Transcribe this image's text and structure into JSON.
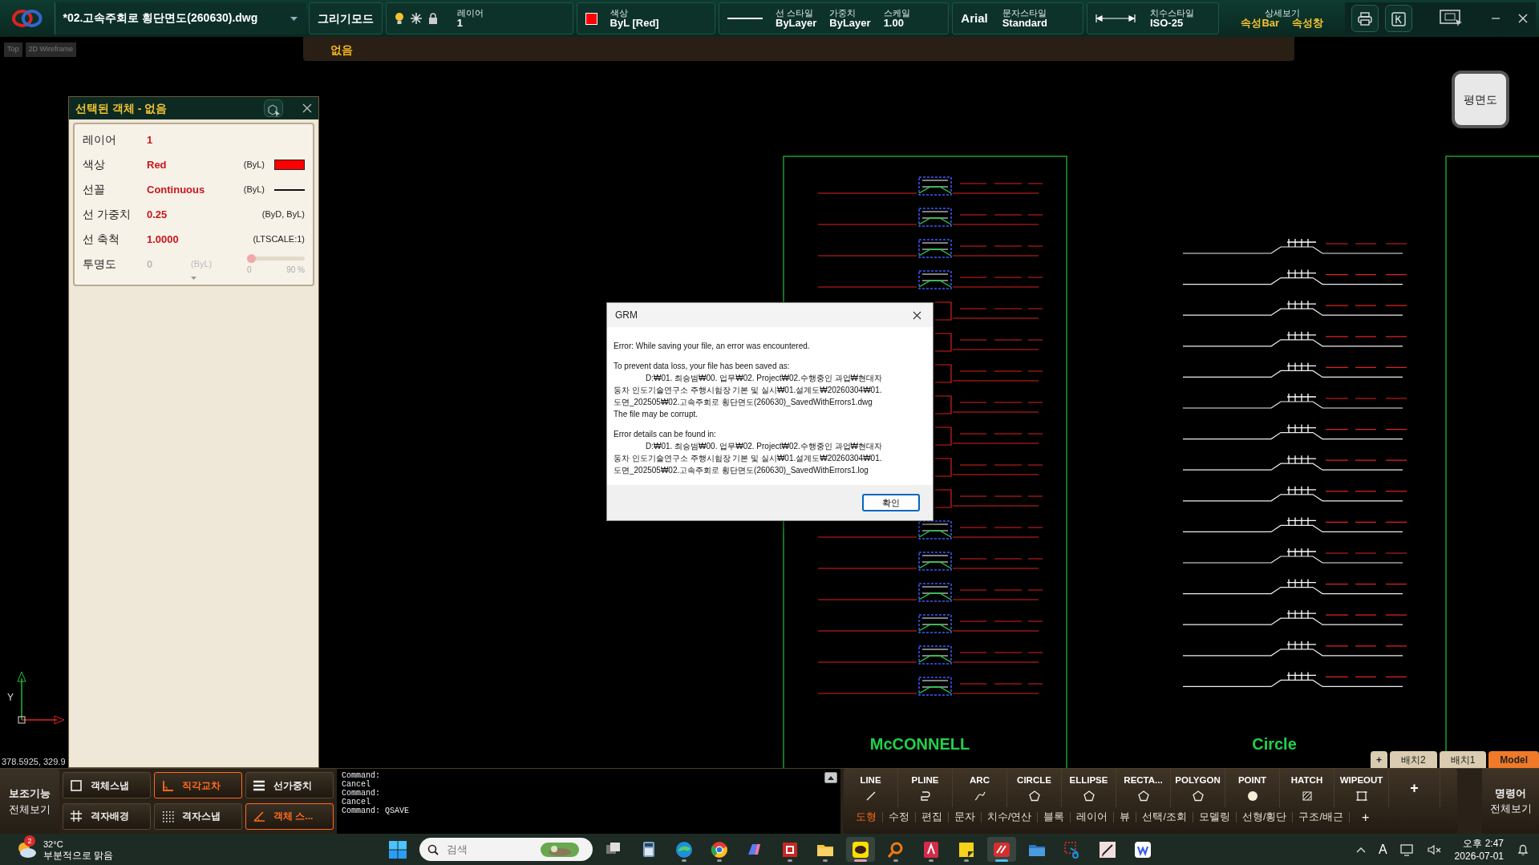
{
  "title_bar": {
    "file_name": "*02.고속주회로 횡단면도(260630).dwg",
    "mode": "그리기모드",
    "layer": {
      "label": "레이어",
      "value": "1"
    },
    "color": {
      "label": "색상",
      "value": "ByL [Red]",
      "color": "#ff0000"
    },
    "line_props": [
      {
        "label": "선 스타일",
        "value": "ByLayer"
      },
      {
        "label": "가중치",
        "value": "ByLayer"
      },
      {
        "label": "스케일",
        "value": "1.00"
      }
    ],
    "font": "Arial",
    "text_style": {
      "label": "문자스타일",
      "value": "Standard"
    },
    "dim_style": {
      "label": "치수스타일",
      "value": "ISO-25"
    },
    "detail": {
      "label": "상세보기",
      "links": [
        "속성Bar",
        "속성창"
      ]
    }
  },
  "selection_strip": "없음",
  "view_labels": [
    "Top",
    "2D Wireframe"
  ],
  "properties": {
    "title": "선택된 객체 - 없음",
    "rows": [
      {
        "kind": "text",
        "label": "레이어",
        "value": "1"
      },
      {
        "kind": "color",
        "label": "색상",
        "value": "Red",
        "source": "(ByL)",
        "color": "#ff0000"
      },
      {
        "kind": "line",
        "label": "선꼴",
        "value": "Continuous",
        "source": "(ByL)"
      },
      {
        "kind": "text",
        "label": "선 가중치",
        "value": "0.25",
        "source": "(ByD, ByL)"
      },
      {
        "kind": "text",
        "label": "선 축척",
        "value": "1.0000",
        "source": "(LTSCALE:1)"
      },
      {
        "kind": "slider",
        "label": "투명도",
        "value": "0",
        "source": "(ByL)",
        "disabled": true,
        "level": 0,
        "min": "0",
        "max": "90 %"
      }
    ]
  },
  "view_button": "평면도",
  "drawing_titles": [
    "McCONNELL",
    "Circle"
  ],
  "ucs": {
    "axis": "Y",
    "coordinates": "378.5925, 329.9"
  },
  "dialog": {
    "title": "GRM",
    "message": "Error: While saving your file, an error was encountered.",
    "saved_intro": "To prevent data loss, your file has been saved as:",
    "saved_path": [
      "D:₩01. 최승범₩00. 업무₩02. Project₩02.수행중인 과업₩현대자",
      "동차 인도기술연구소 주행시험장 기본 및 실시₩01.설계도₩20260304₩01.",
      "도면_202505₩02.고속주회로 횡단면도(260630)_SavedWithErrors1.dwg"
    ],
    "warning": "The file may be corrupt.",
    "details_intro": "Error details can be found in:",
    "details_path": [
      "D:₩01. 최승범₩00. 업무₩02. Project₩02.수행중인 과업₩현대자",
      "동차 인도기술연구소 주행시험장 기본 및 실시₩01.설계도₩20260304₩01.",
      "도면_202505₩02.고속주회로 횡단면도(260630)_SavedWithErrors1.log"
    ],
    "ok": "확인"
  },
  "layout_tabs": {
    "add": "+",
    "tabs": [
      {
        "label": "배치2",
        "selected": false
      },
      {
        "label": "배치1",
        "selected": false
      },
      {
        "label": "Model",
        "selected": true
      }
    ]
  },
  "aux": [
    "보조기능",
    "전체보기"
  ],
  "snaps": [
    {
      "label": "객체스냅",
      "on": false
    },
    {
      "label": "직각교차",
      "on": true
    },
    {
      "label": "선가중치",
      "on": false
    },
    {
      "label": "격자배경",
      "on": false
    },
    {
      "label": "격자스냅",
      "on": false
    },
    {
      "label": "객체 스...",
      "on": true
    }
  ],
  "command_lines": [
    "Command:",
    "Cancel",
    "Command:",
    "Cancel",
    "Command: QSAVE"
  ],
  "tools": [
    "LINE",
    "PLINE",
    "ARC",
    "CIRCLE",
    "ELLIPSE",
    "RECTA...",
    "POLYGON",
    "POINT",
    "HATCH",
    "WIPEOUT"
  ],
  "tools_add": "+",
  "categories": [
    {
      "label": "도형",
      "selected": true
    },
    {
      "label": "수정",
      "selected": false
    },
    {
      "label": "편집",
      "selected": false
    },
    {
      "label": "문자",
      "selected": false
    },
    {
      "label": "치수/연산",
      "selected": false
    },
    {
      "label": "블록",
      "selected": false
    },
    {
      "label": "레이어",
      "selected": false
    },
    {
      "label": "뷰",
      "selected": false
    },
    {
      "label": "선택/조회",
      "selected": false
    },
    {
      "label": "모델링",
      "selected": false
    },
    {
      "label": "선형/횡단",
      "selected": false
    },
    {
      "label": "구조/배근",
      "selected": false
    }
  ],
  "categories_add": "+",
  "command_all": [
    "명령어",
    "전체보기"
  ],
  "taskbar": {
    "weather": {
      "badge": "2",
      "temp": "32°C",
      "text": "부분적으로 맑음"
    },
    "search": {
      "placeholder": "검색"
    },
    "apps": [
      {
        "running": false,
        "active": false
      },
      {
        "running": false,
        "active": false
      },
      {
        "running": true,
        "active": false
      },
      {
        "running": true,
        "active": false
      },
      {
        "running": false,
        "active": false
      },
      {
        "running": true,
        "active": false
      },
      {
        "running": true,
        "active": false
      },
      {
        "running": true,
        "active": true
      },
      {
        "running": true,
        "active": false
      },
      {
        "running": true,
        "active": false
      },
      {
        "running": true,
        "active": false
      },
      {
        "running": true,
        "active": true
      },
      {
        "running": false,
        "active": false
      },
      {
        "running": false,
        "active": false
      },
      {
        "running": false,
        "active": false
      },
      {
        "running": false,
        "active": false
      }
    ],
    "ime": "A",
    "time": "오후 2:47",
    "date": "2026-07-01"
  }
}
